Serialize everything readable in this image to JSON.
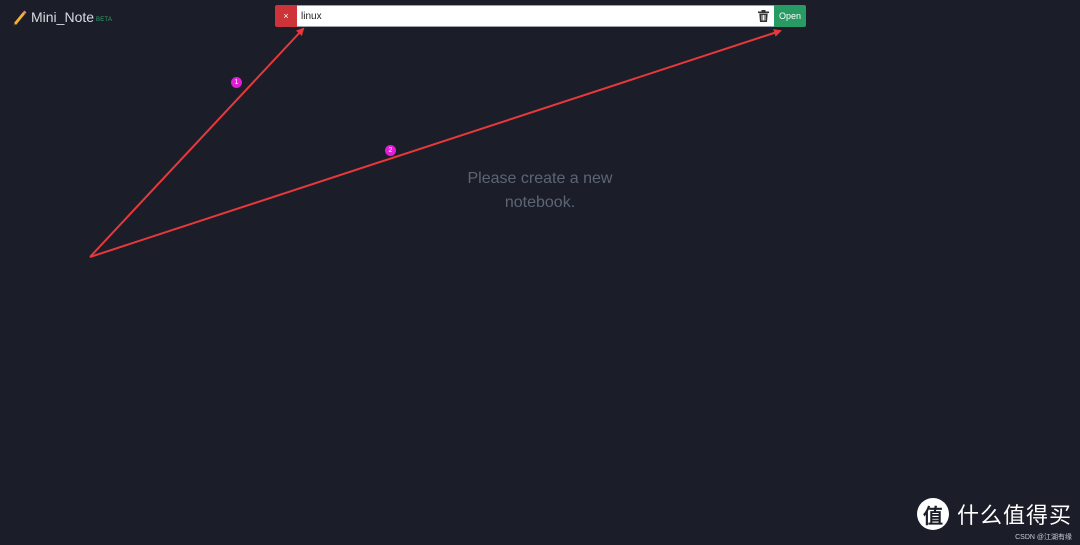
{
  "brand": {
    "title": "Mini_Note",
    "badge": "BETA",
    "icon": "pencil-icon"
  },
  "toolbar": {
    "close_label": "×",
    "input_value": "linux",
    "trash_icon": "trash-icon",
    "open_label": "Open"
  },
  "main": {
    "empty_line1": "Please create a new",
    "empty_line2": "notebook."
  },
  "annotations": {
    "marker_1": "1",
    "marker_2": "2"
  },
  "watermark": {
    "logo_text": "值",
    "text": "什么值得买",
    "sub": "CSDN @江湖有缘"
  },
  "colors": {
    "background": "#1b1e28",
    "close_button": "#cc3439",
    "open_button": "#279b63",
    "arrow": "#e8383b",
    "marker": "#e31cd8"
  }
}
